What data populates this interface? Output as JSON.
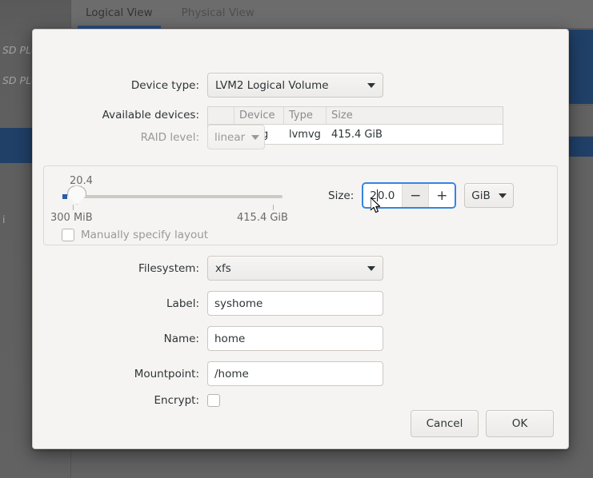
{
  "background": {
    "tabs": [
      {
        "label": "Logical View",
        "active": true
      },
      {
        "label": "Physical View",
        "active": false
      }
    ],
    "sidebar_items": [
      {
        "label": "SD PLUS",
        "selected": false,
        "italic": true
      },
      {
        "label": "SD PLUS",
        "selected": false,
        "italic": true
      },
      {
        "label": "",
        "selected": true,
        "italic": false
      },
      {
        "label": "i",
        "selected": false,
        "italic": false
      }
    ],
    "accent_color": "#2a5da8",
    "selection_color": "#1e4b84"
  },
  "dialog": {
    "device_type": {
      "label": "Device type:",
      "value": "LVM2 Logical Volume",
      "icon": "chevron-down-icon"
    },
    "available_devices": {
      "label": "Available devices:",
      "columns": [
        "",
        "Device",
        "Type",
        "Size"
      ],
      "rows": [
        {
          "checked": true,
          "device": "usrvg",
          "type": "lvmvg",
          "size": "415.4 GiB"
        }
      ]
    },
    "raid_level": {
      "label": "RAID level:",
      "value": "linear",
      "disabled": true,
      "icon": "chevron-down-icon"
    },
    "size_section": {
      "slider_value_tooltip": "20.4",
      "min_label": "300 MiB",
      "max_label": "415.4 GiB",
      "manual_layout_label": "Manually specify layout",
      "manual_layout_checked": false,
      "manual_layout_disabled": true,
      "size_label": "Size:",
      "size_value": "20.0",
      "decrement_label": "−",
      "increment_label": "+",
      "unit_value": "GiB",
      "unit_icon": "chevron-down-icon"
    },
    "filesystem": {
      "label": "Filesystem:",
      "value": "xfs",
      "icon": "chevron-down-icon"
    },
    "fields": [
      {
        "label": "Label:",
        "value": "syshome",
        "placeholder": ""
      },
      {
        "label": "Name:",
        "value": "home",
        "placeholder": ""
      },
      {
        "label": "Mountpoint:",
        "value": "/home",
        "placeholder": ""
      }
    ],
    "encrypt": {
      "label": "Encrypt:",
      "checked": false
    },
    "buttons": {
      "cancel": "Cancel",
      "ok": "OK"
    },
    "accent_color": "#3584e4"
  }
}
